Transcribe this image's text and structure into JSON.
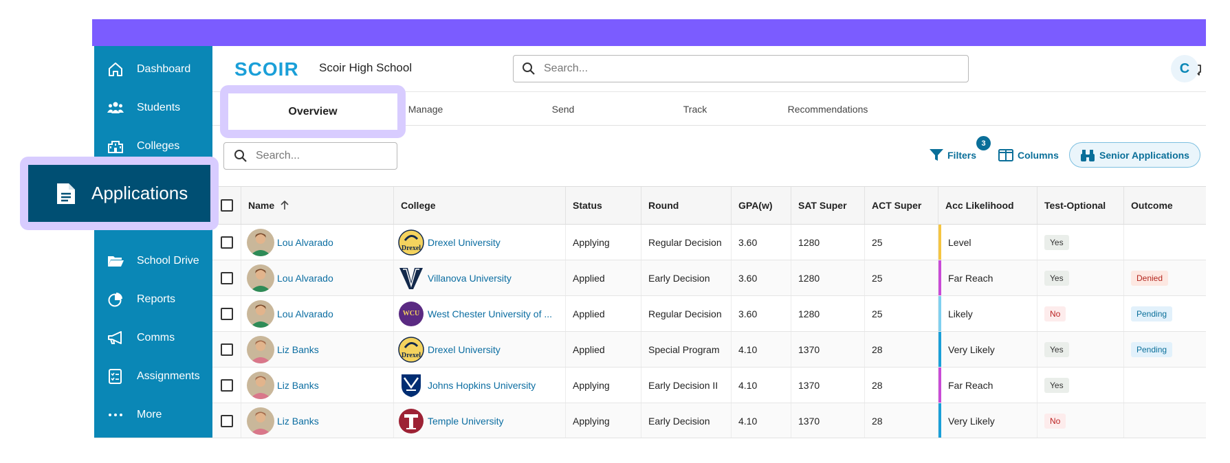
{
  "brand": {
    "logo": "SCOIR",
    "school": "Scoir High School",
    "accent": "#7b5cff",
    "sidebar_color": "#0a87b6"
  },
  "header": {
    "search_placeholder": "Search...",
    "avatar_initial": "C",
    "avatar_overflow": "c"
  },
  "sidebar": {
    "items": [
      {
        "label": "Dashboard",
        "icon": "home-icon"
      },
      {
        "label": "Students",
        "icon": "students-icon"
      },
      {
        "label": "Colleges",
        "icon": "college-building-icon"
      },
      {
        "label": "Applications",
        "icon": "document-icon"
      },
      {
        "label": "School Drive",
        "icon": "folder-icon"
      },
      {
        "label": "Reports",
        "icon": "pie-chart-icon"
      },
      {
        "label": "Comms",
        "icon": "megaphone-icon"
      },
      {
        "label": "Assignments",
        "icon": "checklist-icon"
      },
      {
        "label": "More",
        "icon": "more-dots-icon"
      }
    ]
  },
  "tabs": [
    {
      "label": "Overview",
      "active": true
    },
    {
      "label": "Manage"
    },
    {
      "label": "Send"
    },
    {
      "label": "Track"
    },
    {
      "label": "Recommendations"
    }
  ],
  "toolbar": {
    "search_placeholder": "Search...",
    "filters_label": "Filters",
    "filters_count": "3",
    "columns_label": "Columns",
    "senior_label": "Senior Applications"
  },
  "table": {
    "headers": [
      "Name",
      "College",
      "Status",
      "Round",
      "GPA(w)",
      "SAT Super",
      "ACT Super",
      "Acc Likelihood",
      "Test-Optional",
      "Outcome"
    ],
    "rows": [
      {
        "name": "Lou Alvarado",
        "college": "Drexel University",
        "status": "Applying",
        "round": "Regular Decision",
        "gpa": "3.60",
        "sat": "1280",
        "act": "25",
        "likelihood": "Level",
        "likelihood_color": "#f5c542",
        "test_optional": "Yes",
        "outcome": ""
      },
      {
        "name": "Lou Alvarado",
        "college": "Villanova University",
        "status": "Applied",
        "round": "Early Decision",
        "gpa": "3.60",
        "sat": "1280",
        "act": "25",
        "likelihood": "Far Reach",
        "likelihood_color": "#c94bd6",
        "test_optional": "Yes",
        "outcome": "Denied"
      },
      {
        "name": "Lou Alvarado",
        "college": "West Chester University of ...",
        "status": "Applied",
        "round": "Regular Decision",
        "gpa": "3.60",
        "sat": "1280",
        "act": "25",
        "likelihood": "Likely",
        "likelihood_color": "#7fd0f0",
        "test_optional": "No",
        "outcome": "Pending"
      },
      {
        "name": "Liz Banks",
        "college": "Drexel University",
        "status": "Applied",
        "round": "Special Program",
        "gpa": "4.10",
        "sat": "1370",
        "act": "28",
        "likelihood": "Very Likely",
        "likelihood_color": "#1a9fd8",
        "test_optional": "Yes",
        "outcome": "Pending"
      },
      {
        "name": "Liz Banks",
        "college": "Johns Hopkins University",
        "status": "Applying",
        "round": "Early Decision II",
        "gpa": "4.10",
        "sat": "1370",
        "act": "28",
        "likelihood": "Far Reach",
        "likelihood_color": "#c94bd6",
        "test_optional": "Yes",
        "outcome": ""
      },
      {
        "name": "Liz Banks",
        "college": "Temple University",
        "status": "Applying",
        "round": "Early Decision",
        "gpa": "4.10",
        "sat": "1370",
        "act": "28",
        "likelihood": "Very Likely",
        "likelihood_color": "#1a9fd8",
        "test_optional": "No",
        "outcome": ""
      }
    ]
  },
  "college_logo_text": {
    "Drexel University": "Drexel",
    "West Chester University of ...": "WCU"
  }
}
